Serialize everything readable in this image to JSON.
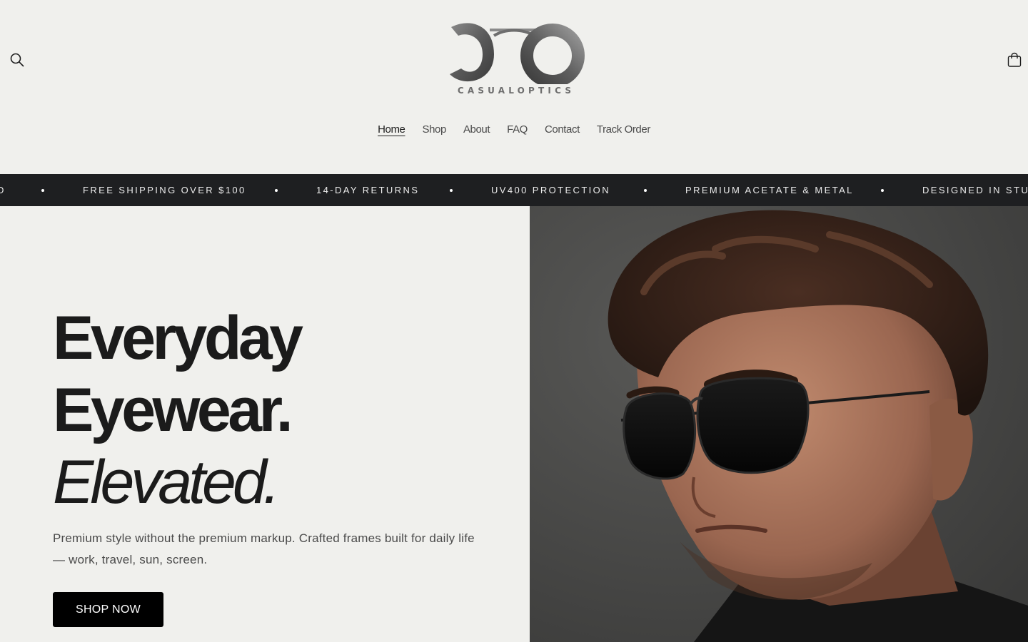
{
  "brand": {
    "name": "CASUALOPTICS"
  },
  "header": {
    "search_icon": "search-icon",
    "cart_icon": "shopping-bag-icon"
  },
  "nav": {
    "items": [
      {
        "label": "Home",
        "active": true
      },
      {
        "label": "Shop"
      },
      {
        "label": "About"
      },
      {
        "label": "FAQ"
      },
      {
        "label": "Contact"
      },
      {
        "label": "Track Order"
      }
    ]
  },
  "ticker": {
    "items": [
      "D",
      "FREE SHIPPING OVER $100",
      "14-DAY RETURNS",
      "UV400 PROTECTION",
      "PREMIUM ACETATE & METAL",
      "DESIGNED IN STUD"
    ]
  },
  "hero": {
    "line1": "Everyday",
    "line2": "Eyewear.",
    "line3": "Elevated.",
    "subtitle": "Premium style without the premium markup. Crafted frames built for daily life — work, travel, sun, screen.",
    "cta": "SHOP NOW",
    "image_subject": "man-wearing-black-sunglasses"
  },
  "colors": {
    "background": "#f0f0ed",
    "ticker_bg": "#1e1f21",
    "button_bg": "#000000",
    "text": "#1b1b1b"
  }
}
